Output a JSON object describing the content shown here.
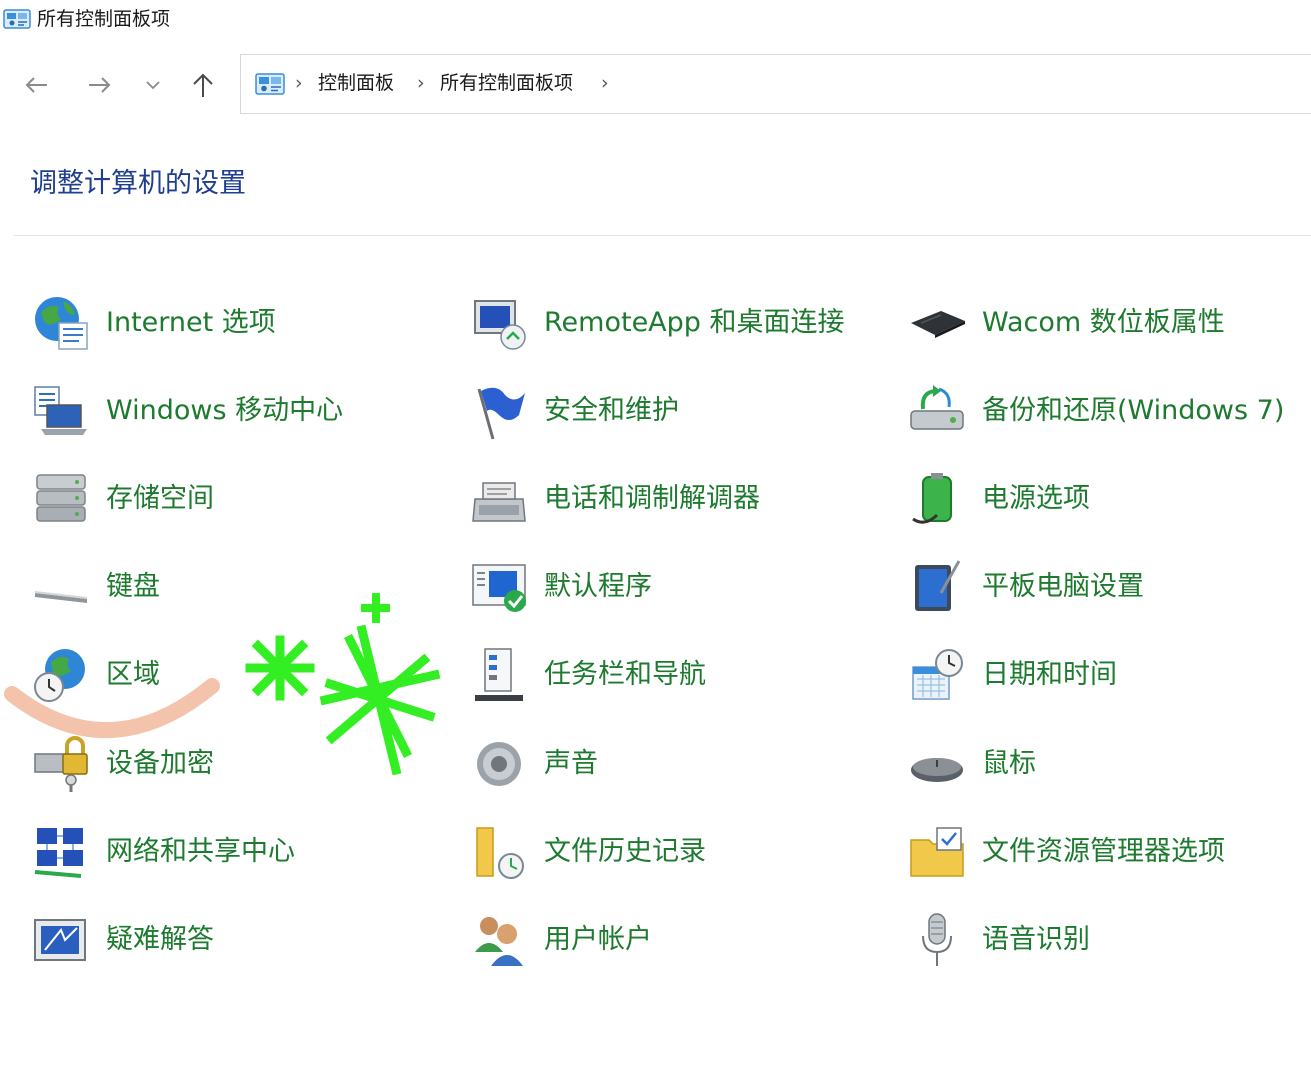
{
  "window": {
    "title": "所有控制面板项",
    "icon": "control-panel-icon"
  },
  "nav": {
    "back_icon": "arrow-left-icon",
    "forward_icon": "arrow-right-icon",
    "recent_icon": "chevron-down-icon",
    "up_icon": "arrow-up-icon"
  },
  "address": {
    "icon": "control-panel-icon",
    "separator": "›",
    "crumbs": [
      "控制面板",
      "所有控制面板项"
    ]
  },
  "page": {
    "heading": "调整计算机的设置"
  },
  "items": [
    {
      "label": "Internet 选项",
      "icon": "globe-settings-icon"
    },
    {
      "label": "RemoteApp 和桌面连接",
      "icon": "remote-desktop-icon"
    },
    {
      "label": "Wacom 数位板属性",
      "icon": "pen-tablet-icon"
    },
    {
      "label": "Windows 移动中心",
      "icon": "laptop-checklist-icon"
    },
    {
      "label": "安全和维护",
      "icon": "flag-icon"
    },
    {
      "label": "备份和还原(Windows 7)",
      "icon": "backup-drive-icon"
    },
    {
      "label": "存储空间",
      "icon": "storage-stack-icon"
    },
    {
      "label": "电话和调制解调器",
      "icon": "fax-phone-icon"
    },
    {
      "label": "电源选项",
      "icon": "battery-plug-icon"
    },
    {
      "label": "键盘",
      "icon": "keyboard-icon"
    },
    {
      "label": "默认程序",
      "icon": "default-programs-icon"
    },
    {
      "label": "平板电脑设置",
      "icon": "tablet-pen-icon"
    },
    {
      "label": "区域",
      "icon": "globe-clock-icon"
    },
    {
      "label": "任务栏和导航",
      "icon": "taskbar-icon"
    },
    {
      "label": "日期和时间",
      "icon": "calendar-clock-icon"
    },
    {
      "label": "设备加密",
      "icon": "lock-keys-icon"
    },
    {
      "label": "声音",
      "icon": "speaker-icon"
    },
    {
      "label": "鼠标",
      "icon": "mouse-icon"
    },
    {
      "label": "网络和共享中心",
      "icon": "network-icon"
    },
    {
      "label": "文件历史记录",
      "icon": "folder-history-icon"
    },
    {
      "label": "文件资源管理器选项",
      "icon": "folder-check-icon"
    },
    {
      "label": "疑难解答",
      "icon": "troubleshoot-monitor-icon"
    },
    {
      "label": "用户帐户",
      "icon": "users-icon"
    },
    {
      "label": "语音识别",
      "icon": "microphone-icon"
    }
  ],
  "colors": {
    "link_green": "#1d7a2e",
    "heading_blue": "#1e3e8f",
    "overlay_green": "#33ee22",
    "overlay_peach": "#f3c4ab"
  }
}
